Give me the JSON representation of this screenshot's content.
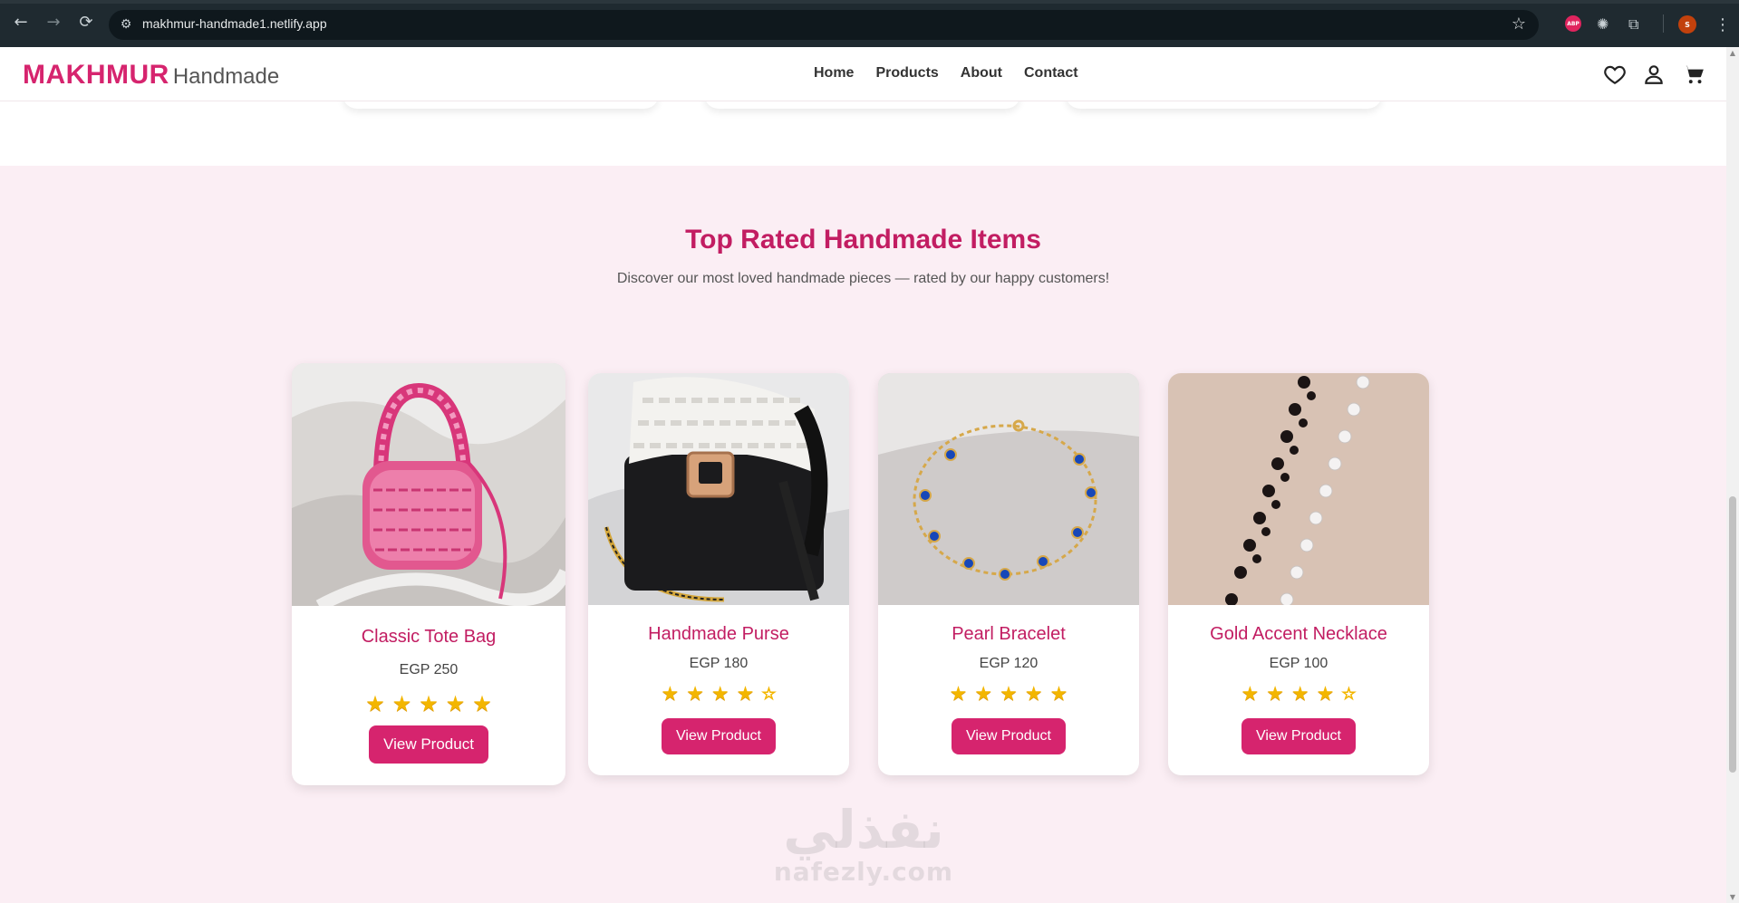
{
  "browser": {
    "url": "makhmur-handmade1.netlify.app",
    "back_icon": "←",
    "forward_icon": "→",
    "reload_icon": "⟳",
    "abp_label": "ABP",
    "profile_initial": "S"
  },
  "header": {
    "brand_main": "MAKHMUR",
    "brand_sub": "Handmade",
    "nav": [
      "Home",
      "Products",
      "About",
      "Contact"
    ]
  },
  "section": {
    "title": "Top Rated Handmade Items",
    "subtitle": "Discover our most loved handmade pieces — rated by our happy customers!",
    "products": [
      {
        "name": "Classic Tote Bag",
        "price": "EGP 250",
        "rating": 5,
        "button": "View Product"
      },
      {
        "name": "Handmade Purse",
        "price": "EGP 180",
        "rating": 4,
        "button": "View Product"
      },
      {
        "name": "Pearl Bracelet",
        "price": "EGP 120",
        "rating": 5,
        "button": "View Product"
      },
      {
        "name": "Gold Accent Necklace",
        "price": "EGP 100",
        "rating": 4,
        "button": "View Product"
      }
    ]
  },
  "watermark": {
    "arabic": "نفذلي",
    "latin": "nafezly.com"
  },
  "colors": {
    "brand": "#d6246e",
    "title": "#c21d62",
    "section_bg": "#fbeef4",
    "star": "#f3b600"
  }
}
